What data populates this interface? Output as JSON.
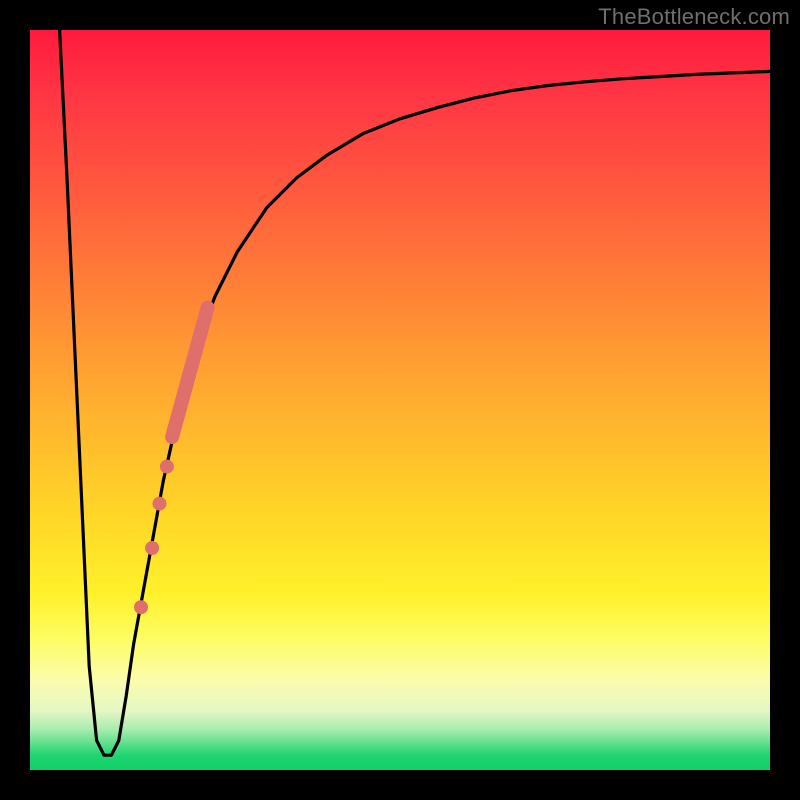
{
  "watermark": "TheBottleneck.com",
  "chart_data": {
    "type": "line",
    "title": "",
    "xlabel": "",
    "ylabel": "",
    "xlim": [
      0,
      100
    ],
    "ylim": [
      0,
      100
    ],
    "series": [
      {
        "name": "bottleneck-curve",
        "x": [
          4,
          5,
          6,
          7,
          8,
          9,
          10,
          11,
          12,
          13,
          14,
          16,
          18,
          20,
          22,
          25,
          28,
          32,
          36,
          40,
          45,
          50,
          55,
          60,
          65,
          70,
          75,
          80,
          85,
          90,
          95,
          100
        ],
        "y": [
          100,
          80,
          58,
          36,
          14,
          4,
          2,
          2,
          4,
          10,
          17,
          28,
          39,
          48,
          56,
          64,
          70,
          76,
          80,
          83,
          86,
          88,
          89.5,
          90.8,
          91.8,
          92.5,
          93,
          93.4,
          93.7,
          94,
          94.2,
          94.4
        ]
      }
    ],
    "markers": [
      {
        "name": "pink-dot",
        "shape": "circle",
        "color": "#e06f6b",
        "points": [
          {
            "x": 15.0,
            "y": 22.0
          },
          {
            "x": 16.5,
            "y": 30.0
          },
          {
            "x": 17.5,
            "y": 36.0
          },
          {
            "x": 18.5,
            "y": 41.0
          }
        ]
      },
      {
        "name": "pink-band",
        "shape": "segment",
        "color": "#e06f6b",
        "from": {
          "x": 19.2,
          "y": 45.0
        },
        "to": {
          "x": 24.0,
          "y": 62.5
        }
      }
    ],
    "background_gradient": {
      "direction": "vertical",
      "stops": [
        {
          "pos": 0.0,
          "color": "#ff1a3c"
        },
        {
          "pos": 0.5,
          "color": "#ffb22e"
        },
        {
          "pos": 0.8,
          "color": "#fff02a"
        },
        {
          "pos": 0.92,
          "color": "#e4f7c4"
        },
        {
          "pos": 1.0,
          "color": "#0fcf66"
        }
      ]
    }
  }
}
